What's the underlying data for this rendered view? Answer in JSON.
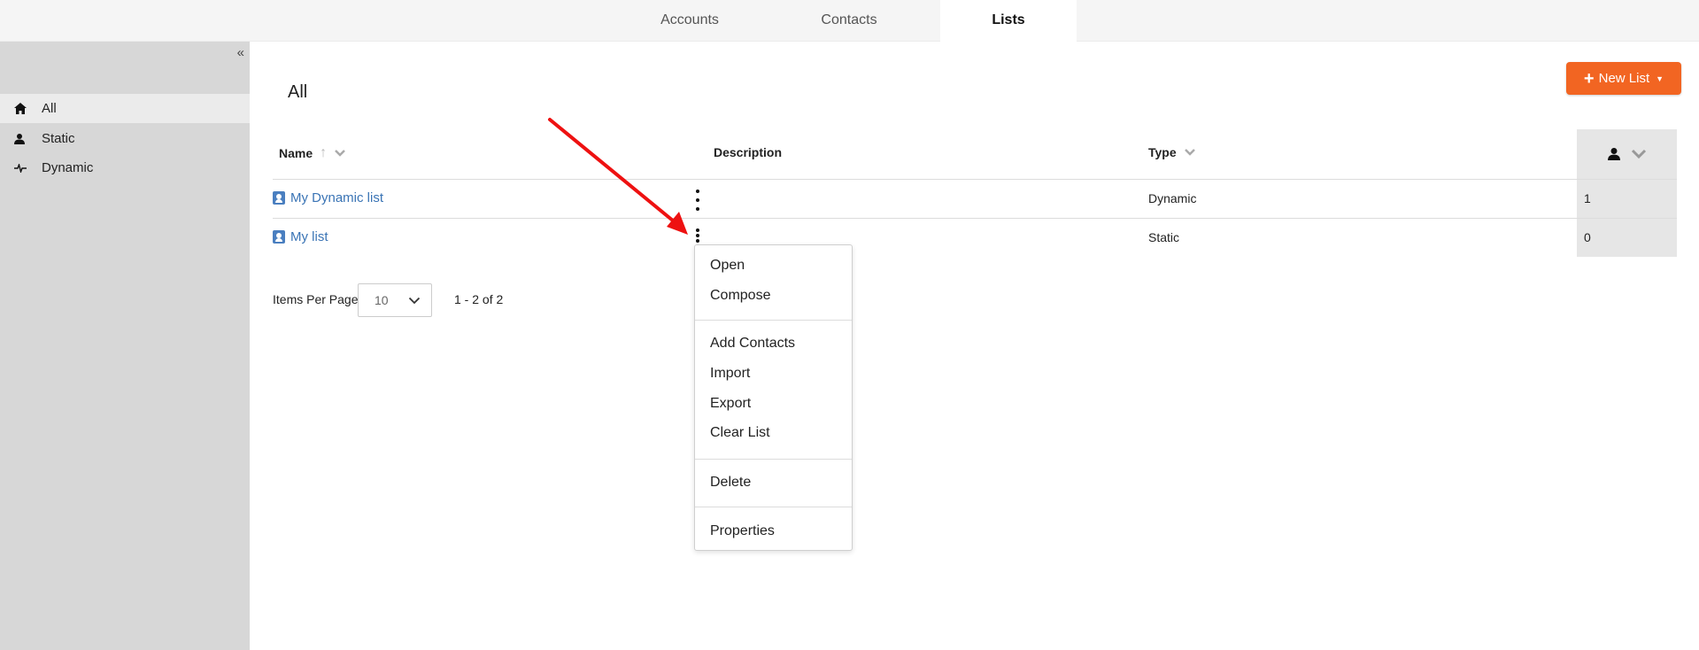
{
  "top_tabs": [
    {
      "label": "Accounts"
    },
    {
      "label": "Contacts"
    },
    {
      "label": "Lists",
      "active": true
    }
  ],
  "sidebar": {
    "collapse_icon": "double-chevron-left-icon",
    "items": [
      {
        "label": "All",
        "icon": "home-icon",
        "active": true
      },
      {
        "label": "Static",
        "icon": "person-icon"
      },
      {
        "label": "Dynamic",
        "icon": "pulse-icon"
      }
    ]
  },
  "main": {
    "title": "All",
    "new_list_button": "New List",
    "table": {
      "columns": [
        "Name",
        "Description",
        "Type"
      ],
      "rows": [
        {
          "name": "My Dynamic list",
          "description": "",
          "type": "Dynamic",
          "count": "1"
        },
        {
          "name": "My list",
          "description": "",
          "type": "Static",
          "count": "0"
        }
      ]
    },
    "pagination": {
      "items_per_page_label": "Items Per Page",
      "items_per_page_value": "10",
      "range": "1 - 2 of 2"
    }
  },
  "context_menu": {
    "groups": [
      [
        "Open",
        "Compose"
      ],
      [
        "Add Contacts",
        "Import",
        "Export",
        "Clear List"
      ],
      [
        "Delete"
      ],
      [
        "Properties"
      ]
    ]
  },
  "colors": {
    "accent": "#f26522",
    "link": "#3a74b5",
    "annotation_arrow": "#ee1111"
  }
}
